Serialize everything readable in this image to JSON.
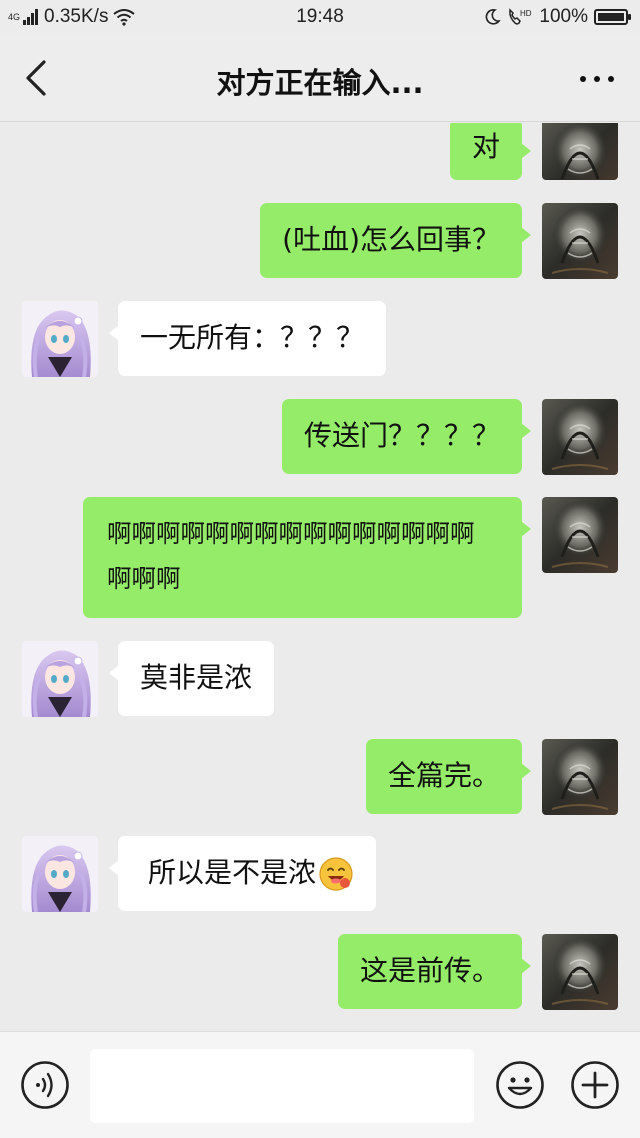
{
  "status_bar": {
    "network": "4G",
    "speed": "0.35K/s",
    "time": "19:48",
    "hd_label": "HD",
    "battery": "100%",
    "battery_level": 1.0
  },
  "nav": {
    "title": "对方正在输入..."
  },
  "colors": {
    "outgoing_bubble": "#95ec69",
    "incoming_bubble": "#ffffff",
    "chat_background": "#ebebeb"
  },
  "messages": [
    {
      "side": "out",
      "text": "对"
    },
    {
      "side": "out",
      "text": "(吐血)怎么回事？"
    },
    {
      "side": "in",
      "text": "一无所有：？？？"
    },
    {
      "side": "out",
      "text": "传送门？？？？"
    },
    {
      "side": "out",
      "text": "啊啊啊啊啊啊啊啊啊啊啊啊啊啊啊啊啊啊"
    },
    {
      "side": "in",
      "text": "莫非是浓"
    },
    {
      "side": "out",
      "text": "全篇完。"
    },
    {
      "side": "in",
      "text": "所以是不是浓",
      "emoji": "grinning-face-icon"
    },
    {
      "side": "out",
      "text": "这是前传。"
    }
  ],
  "input_bar": {
    "placeholder": "",
    "icons": [
      "voice-icon",
      "emoji-icon",
      "plus-icon"
    ]
  }
}
